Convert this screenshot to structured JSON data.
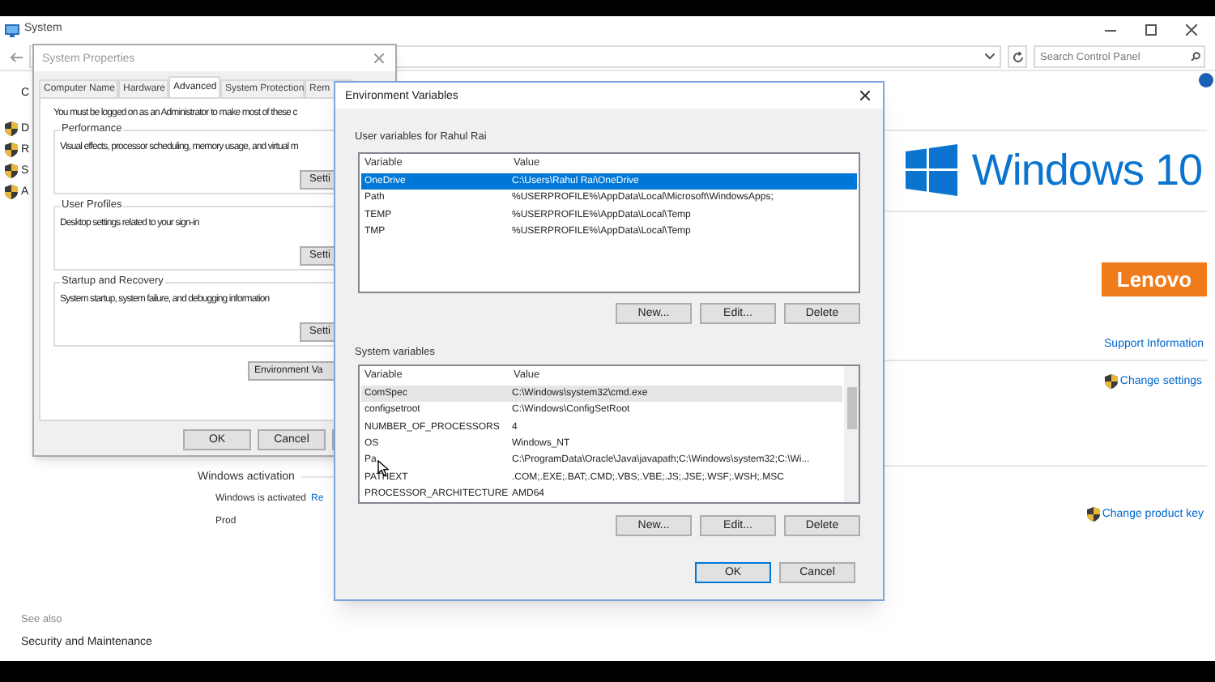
{
  "system_window": {
    "title": "System",
    "search": {
      "placeholder": "Search Control Panel"
    },
    "sidebar_home": "C",
    "tasks": [
      "D",
      "R",
      "S",
      "A"
    ],
    "os_logo": "Windows 10",
    "oem_logo": "Lenovo",
    "support_link": "Support Information",
    "change_settings_link": "Change settings",
    "activation": {
      "heading": "Windows activation",
      "status": "Windows is activated",
      "status_link": "Re",
      "product_label": "Prod",
      "change_key_link": "Change product key"
    },
    "see_also": {
      "heading": "See also",
      "links": [
        "Security and Maintenance"
      ]
    }
  },
  "system_properties": {
    "title": "System Properties",
    "tabs": [
      {
        "label": "Computer Name",
        "selected": false
      },
      {
        "label": "Hardware",
        "selected": false
      },
      {
        "label": "Advanced",
        "selected": true
      },
      {
        "label": "System Protection",
        "selected": false
      },
      {
        "label": "Rem",
        "selected": false
      }
    ],
    "notice": "You must be logged on as an Administrator to make most of these c",
    "groups": [
      {
        "title": "Performance",
        "description": "Visual effects, processor scheduling, memory usage, and virtual m",
        "button": "Setti"
      },
      {
        "title": "User Profiles",
        "description": "Desktop settings related to your sign-in",
        "button": "Setti"
      },
      {
        "title": "Startup and Recovery",
        "description": "System startup, system failure, and debugging information",
        "button": "Setti"
      }
    ],
    "env_button": "Environment Va",
    "buttons": [
      "OK",
      "Cancel"
    ]
  },
  "environment_variables": {
    "title": "Environment Variables",
    "user_section": {
      "label": "User variables for Rahul Rai",
      "columns": [
        "Variable",
        "Value"
      ],
      "rows": [
        {
          "variable": "OneDrive",
          "value": "C:\\Users\\Rahul Rai\\OneDrive",
          "selected": true
        },
        {
          "variable": "Path",
          "value": "%USERPROFILE%\\AppData\\Local\\Microsoft\\WindowsApps;",
          "selected": false
        },
        {
          "variable": "TEMP",
          "value": "%USERPROFILE%\\AppData\\Local\\Temp",
          "selected": false
        },
        {
          "variable": "TMP",
          "value": "%USERPROFILE%\\AppData\\Local\\Temp",
          "selected": false
        }
      ],
      "buttons": [
        "New...",
        "Edit...",
        "Delete"
      ]
    },
    "system_section": {
      "label": "System variables",
      "columns": [
        "Variable",
        "Value"
      ],
      "rows": [
        {
          "variable": "ComSpec",
          "value": "C:\\Windows\\system32\\cmd.exe",
          "selected": true
        },
        {
          "variable": "configsetroot",
          "value": "C:\\Windows\\ConfigSetRoot",
          "selected": false
        },
        {
          "variable": "NUMBER_OF_PROCESSORS",
          "value": "4",
          "selected": false
        },
        {
          "variable": "OS",
          "value": "Windows_NT",
          "selected": false
        },
        {
          "variable": "Pa",
          "value": "C:\\ProgramData\\Oracle\\Java\\javapath;C:\\Windows\\system32;C:\\Wi...",
          "selected": false
        },
        {
          "variable": "PATHEXT",
          "value": ".COM;.EXE;.BAT;.CMD;.VBS;.VBE;.JS;.JSE;.WSF;.WSH;.MSC",
          "selected": false
        },
        {
          "variable": "PROCESSOR_ARCHITECTURE",
          "value": "AMD64",
          "selected": false
        }
      ],
      "buttons": [
        "New...",
        "Edit...",
        "Delete"
      ]
    },
    "buttons": [
      {
        "label": "OK",
        "kind": "default"
      },
      {
        "label": "Cancel",
        "kind": "normal"
      }
    ]
  }
}
